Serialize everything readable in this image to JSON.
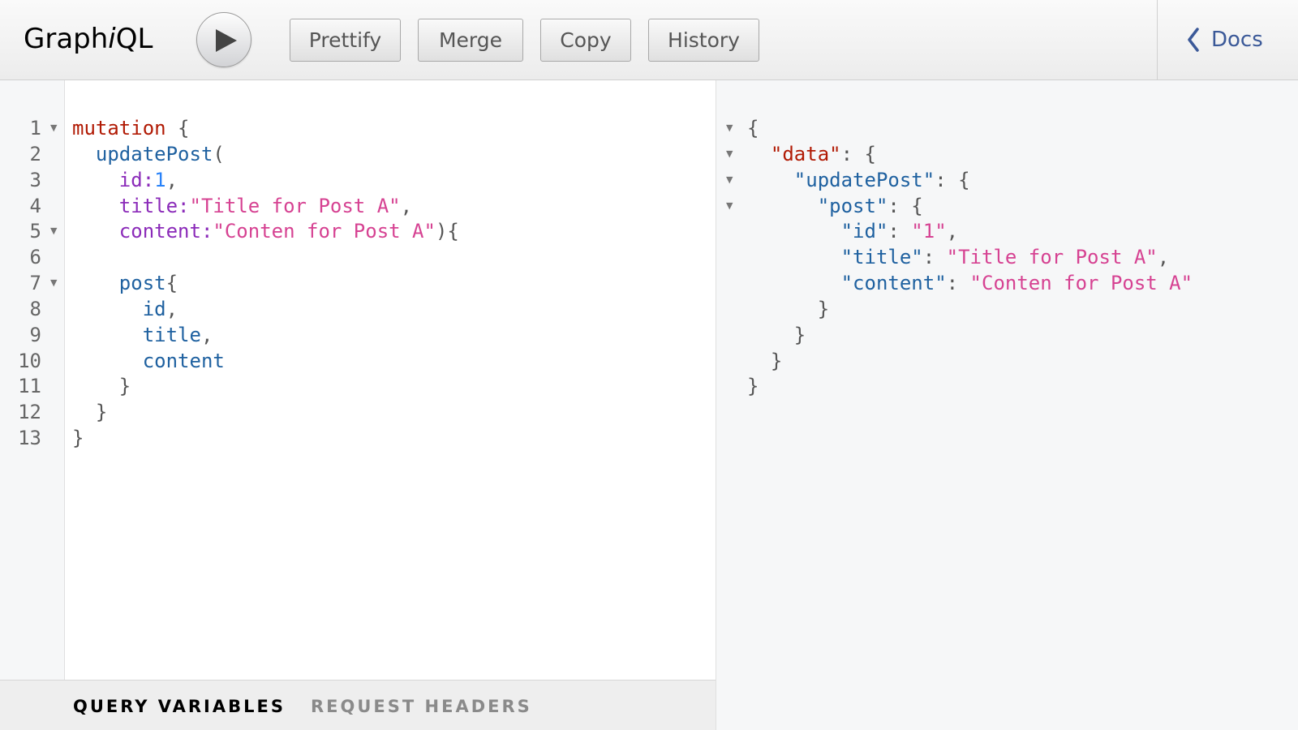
{
  "app": {
    "logo_prefix": "Graph",
    "logo_italic": "i",
    "logo_suffix": "QL"
  },
  "toolbar": {
    "run_label": "Execute Query",
    "prettify": "Prettify",
    "merge": "Merge",
    "copy": "Copy",
    "history": "History",
    "docs": "Docs"
  },
  "editor": {
    "line_numbers": [
      "1",
      "2",
      "3",
      "4",
      "5",
      "6",
      "7",
      "8",
      "9",
      "10",
      "11",
      "12",
      "13"
    ],
    "lines": {
      "l1": {
        "kw": "mutation",
        "rest": " {"
      },
      "l2": {
        "fn": "  updatePost",
        "rest": "("
      },
      "l3": {
        "arg": "    id",
        "colon": ":",
        "val": "1",
        "rest": ","
      },
      "l4": {
        "arg": "    title",
        "colon": ":",
        "val": "\"Title for Post A\"",
        "rest": ","
      },
      "l5": {
        "arg": "    content",
        "colon": ":",
        "val": "\"Conten for Post A\"",
        "rest": "){"
      },
      "l7": {
        "fn": "    post",
        "rest": "{"
      },
      "l8": {
        "fn": "      id",
        "rest": ","
      },
      "l9": {
        "fn": "      title",
        "rest": ","
      },
      "l10": {
        "fn": "      content",
        "rest": ""
      },
      "l11": {
        "rest": "    }"
      },
      "l12": {
        "rest": "  }"
      },
      "l13": {
        "rest": "}"
      }
    }
  },
  "bottom_tabs": {
    "query_variables": "QUERY VARIABLES",
    "request_headers": "REQUEST HEADERS"
  },
  "result": {
    "r1": "{",
    "r2": {
      "key": "\"data\"",
      "rest": ": {"
    },
    "r3": {
      "key": "\"updatePost\"",
      "rest": ": {"
    },
    "r4": {
      "key": "\"post\"",
      "rest": ": {"
    },
    "r5": {
      "key": "\"id\"",
      "sep": ": ",
      "val": "\"1\"",
      "rest": ","
    },
    "r6": {
      "key": "\"title\"",
      "sep": ": ",
      "val": "\"Title for Post A\"",
      "rest": ","
    },
    "r7": {
      "key": "\"content\"",
      "sep": ": ",
      "val": "\"Conten for Post A\"",
      "rest": ""
    },
    "r8": "      }",
    "r9": "    }",
    "r10": "  }",
    "r11": "}"
  },
  "colors": {
    "keyword": "#b11a04",
    "field": "#1f61a0",
    "argument": "#8b2bb9",
    "number": "#2882f9",
    "string": "#d64292",
    "docs_link": "#3b5998"
  }
}
